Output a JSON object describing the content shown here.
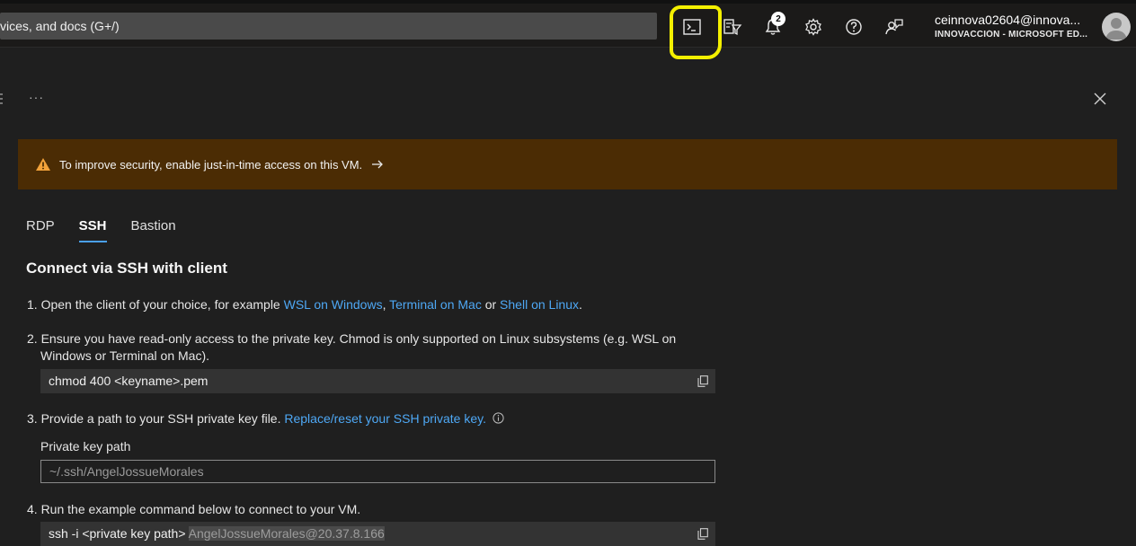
{
  "topbar": {
    "search_text": "vices, and docs (G+/)",
    "notifications_count": "2",
    "account_name": "ceinnova02604@innova...",
    "account_org": "INNOVACCIÓN - MICROSOFT ED..."
  },
  "panel": {
    "more_label": "···",
    "warning_text": "To improve security, enable just-in-time access on this VM.",
    "tabs": [
      "RDP",
      "SSH",
      "Bastion"
    ],
    "heading": "Connect via SSH with client"
  },
  "steps": {
    "s1_prefix": "1. Open the client of your choice, for example ",
    "s1_link1": "WSL on Windows",
    "s1_sep1": ", ",
    "s1_link2": "Terminal on Mac",
    "s1_sep2": " or ",
    "s1_link3": "Shell on Linux",
    "s1_end": ".",
    "s2_line1": "2. Ensure you have read-only access to the private key. Chmod is only supported on Linux subsystems (e.g. WSL on",
    "s2_line2": "Windows or Terminal on Mac).",
    "s2_code": "chmod 400 <keyname>.pem",
    "s3_prefix": "3. Provide a path to your SSH private key file. ",
    "s3_link": "Replace/reset your SSH private key.",
    "private_key_label": "Private key path",
    "private_key_value": "~/.ssh/AngelJossueMorales",
    "s4_text": "4. Run the example command below to connect to your VM.",
    "s4_code_prefix": "ssh -i <private key path> ",
    "s4_code_host": "AngelJossueMorales@20.37.8.166"
  },
  "colors": {
    "link": "#4ea8f5",
    "warning_bg": "#4b2c04",
    "highlight": "#f4f000",
    "tab_underline": "#4aa0f0"
  },
  "icons": [
    "cloud-shell-icon",
    "directory-filter-icon",
    "bell-icon",
    "gear-icon",
    "help-icon",
    "feedback-icon",
    "avatar",
    "close-icon",
    "warning-icon",
    "arrow-right-icon",
    "copy-icon",
    "info-icon"
  ]
}
